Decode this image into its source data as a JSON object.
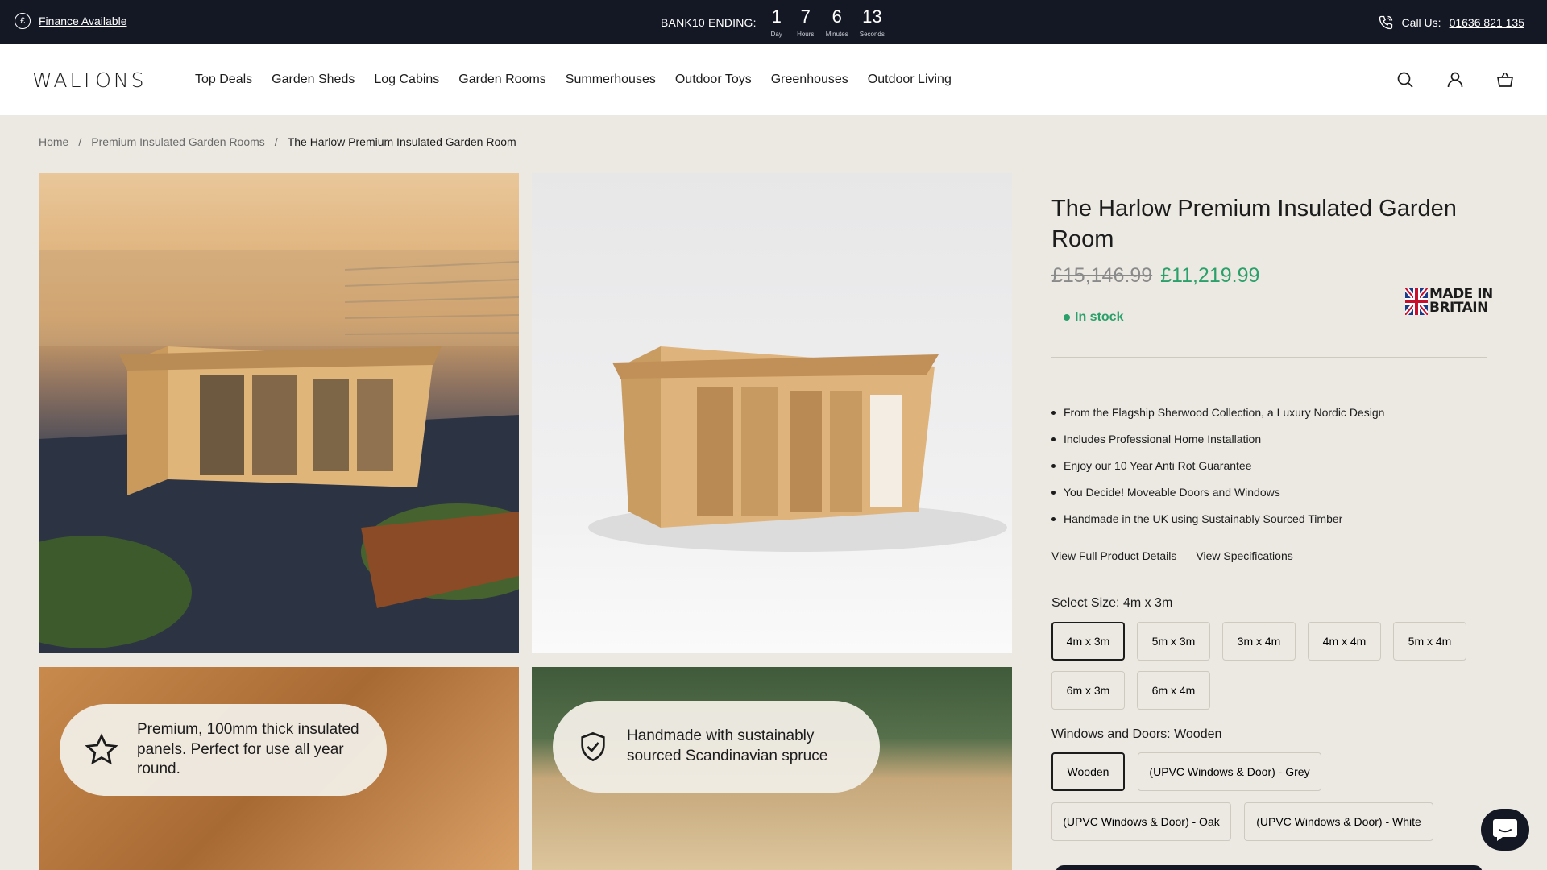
{
  "topbar": {
    "finance_label": "Finance Available",
    "promo_label": "BANK10 ENDING:",
    "countdown": [
      {
        "value": "1",
        "unit": "Day"
      },
      {
        "value": "7",
        "unit": "Hours"
      },
      {
        "value": "6",
        "unit": "Minutes"
      },
      {
        "value": "13",
        "unit": "Seconds"
      }
    ],
    "call_label": "Call Us:",
    "phone": "01636 821 135"
  },
  "header": {
    "logo": "WALTONS",
    "nav": [
      "Top Deals",
      "Garden Sheds",
      "Log Cabins",
      "Garden Rooms",
      "Summerhouses",
      "Outdoor Toys",
      "Greenhouses",
      "Outdoor Living"
    ],
    "icons": [
      "search-icon",
      "account-icon",
      "basket-icon"
    ]
  },
  "breadcrumb": {
    "home": "Home",
    "sep": "/",
    "category": "Premium Insulated Garden Rooms",
    "current": "The Harlow Premium Insulated Garden Room"
  },
  "gallery": {
    "feature1": "Premium, 100mm thick insulated panels. Perfect for use all year round.",
    "feature2": "Handmade with sustainably sourced Scandinavian spruce"
  },
  "product": {
    "title": "The Harlow Premium Insulated Garden Room",
    "old_price": "£15,146.99",
    "price": "£11,219.99",
    "stock": "In stock",
    "badge": "MADE IN BRITAIN",
    "badge_line1": "MADE IN",
    "badge_line2": "BRITAIN",
    "bullets": [
      "From the Flagship Sherwood Collection, a Luxury Nordic Design",
      "Includes Professional Home Installation",
      "Enjoy our 10 Year Anti Rot Guarantee",
      "You Decide! Moveable Doors and Windows",
      "Handmade in the UK using Sustainably Sourced Timber"
    ],
    "details_link": "View Full Product Details",
    "specs_link": "View Specifications",
    "size_label": "Select Size:",
    "size_selected": "4m x 3m",
    "sizes": [
      "4m x 3m",
      "5m x 3m",
      "3m x 4m",
      "4m x 4m",
      "5m x 4m",
      "6m x 3m",
      "6m x 4m"
    ],
    "windows_label": "Windows and Doors:",
    "windows_selected": "Wooden",
    "windows": [
      "Wooden",
      "(UPVC Windows & Door) - Grey",
      "(UPVC Windows & Door) - Oak",
      "(UPVC Windows & Door) - White"
    ]
  },
  "colors": {
    "topbar_bg": "#141824",
    "price_green": "#2aa06a",
    "page_bg": "#ece9e2"
  }
}
